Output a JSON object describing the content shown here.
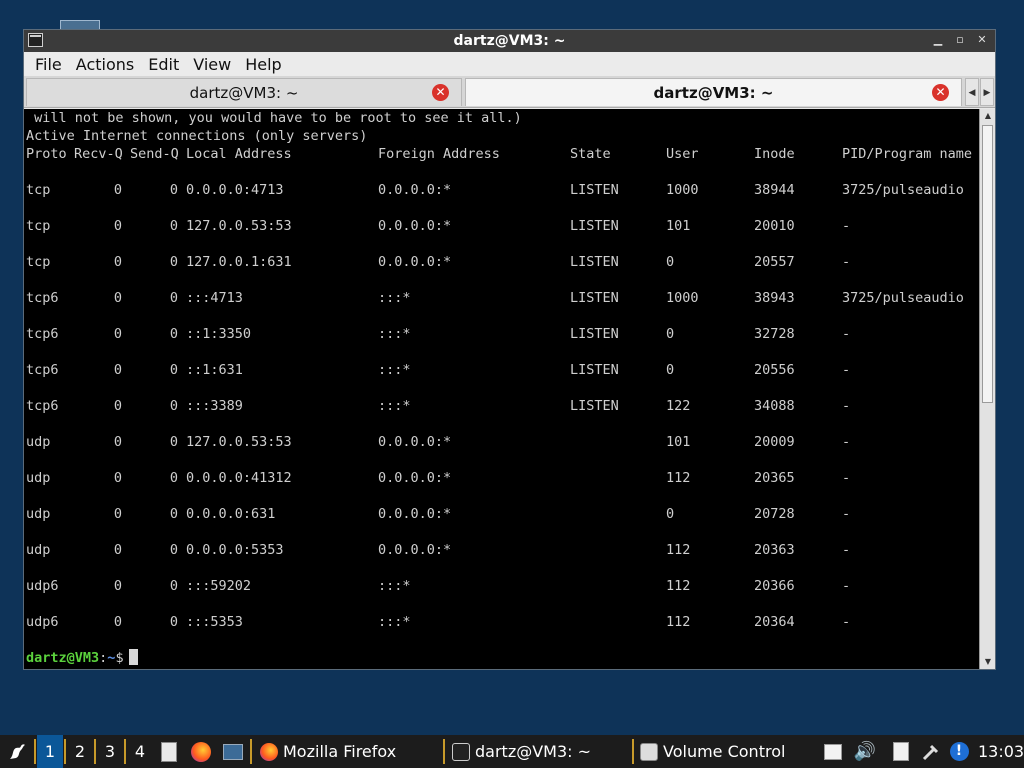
{
  "window": {
    "title": "dartz@VM3: ~",
    "menu": [
      "File",
      "Actions",
      "Edit",
      "View",
      "Help"
    ],
    "tabs": [
      {
        "label": "dartz@VM3: ~",
        "active": false
      },
      {
        "label": "dartz@VM3: ~",
        "active": true
      }
    ]
  },
  "terminal": {
    "pre_lines": [
      " will not be shown, you would have to be root to see it all.)",
      "Active Internet connections (only servers)"
    ],
    "headers": [
      "Proto",
      "Recv-Q",
      "Send-Q",
      "Local Address",
      "Foreign Address",
      "State",
      "User",
      "Inode",
      "PID/Program name"
    ],
    "rows": [
      [
        "tcp",
        "0",
        "0",
        "0.0.0.0:4713",
        "0.0.0.0:*",
        "LISTEN",
        "1000",
        "38944",
        "3725/pulseaudio"
      ],
      [
        "tcp",
        "0",
        "0",
        "127.0.0.53:53",
        "0.0.0.0:*",
        "LISTEN",
        "101",
        "20010",
        "-"
      ],
      [
        "tcp",
        "0",
        "0",
        "127.0.0.1:631",
        "0.0.0.0:*",
        "LISTEN",
        "0",
        "20557",
        "-"
      ],
      [
        "tcp6",
        "0",
        "0",
        ":::4713",
        ":::*",
        "LISTEN",
        "1000",
        "38943",
        "3725/pulseaudio"
      ],
      [
        "tcp6",
        "0",
        "0",
        "::1:3350",
        ":::*",
        "LISTEN",
        "0",
        "32728",
        "-"
      ],
      [
        "tcp6",
        "0",
        "0",
        "::1:631",
        ":::*",
        "LISTEN",
        "0",
        "20556",
        "-"
      ],
      [
        "tcp6",
        "0",
        "0",
        ":::3389",
        ":::*",
        "LISTEN",
        "122",
        "34088",
        "-"
      ],
      [
        "udp",
        "0",
        "0",
        "127.0.0.53:53",
        "0.0.0.0:*",
        "",
        "101",
        "20009",
        "-"
      ],
      [
        "udp",
        "0",
        "0",
        "0.0.0.0:41312",
        "0.0.0.0:*",
        "",
        "112",
        "20365",
        "-"
      ],
      [
        "udp",
        "0",
        "0",
        "0.0.0.0:631",
        "0.0.0.0:*",
        "",
        "0",
        "20728",
        "-"
      ],
      [
        "udp",
        "0",
        "0",
        "0.0.0.0:5353",
        "0.0.0.0:*",
        "",
        "112",
        "20363",
        "-"
      ],
      [
        "udp6",
        "0",
        "0",
        ":::59202",
        ":::*",
        "",
        "112",
        "20366",
        "-"
      ],
      [
        "udp6",
        "0",
        "0",
        ":::5353",
        ":::*",
        "",
        "112",
        "20364",
        "-"
      ]
    ],
    "prompt_user": "dartz@VM3",
    "prompt_sep": ":",
    "prompt_path": "~",
    "prompt_symbol": "$"
  },
  "taskbar": {
    "workspaces": [
      "1",
      "2",
      "3",
      "4"
    ],
    "active_workspace": "1",
    "tasks": [
      {
        "label": "Mozilla Firefox",
        "icon": "firefox-icon"
      },
      {
        "label": "dartz@VM3: ~",
        "icon": "terminal-icon"
      },
      {
        "label": "Volume Control",
        "icon": "volume-control-icon"
      }
    ],
    "clock": "13:03"
  },
  "colors": {
    "desktop": "#0e3358",
    "prompt_user": "#5bd23d",
    "prompt_path": "#5e8fe3",
    "tab_close": "#d9322b",
    "workspace_active": "#0b5798"
  }
}
